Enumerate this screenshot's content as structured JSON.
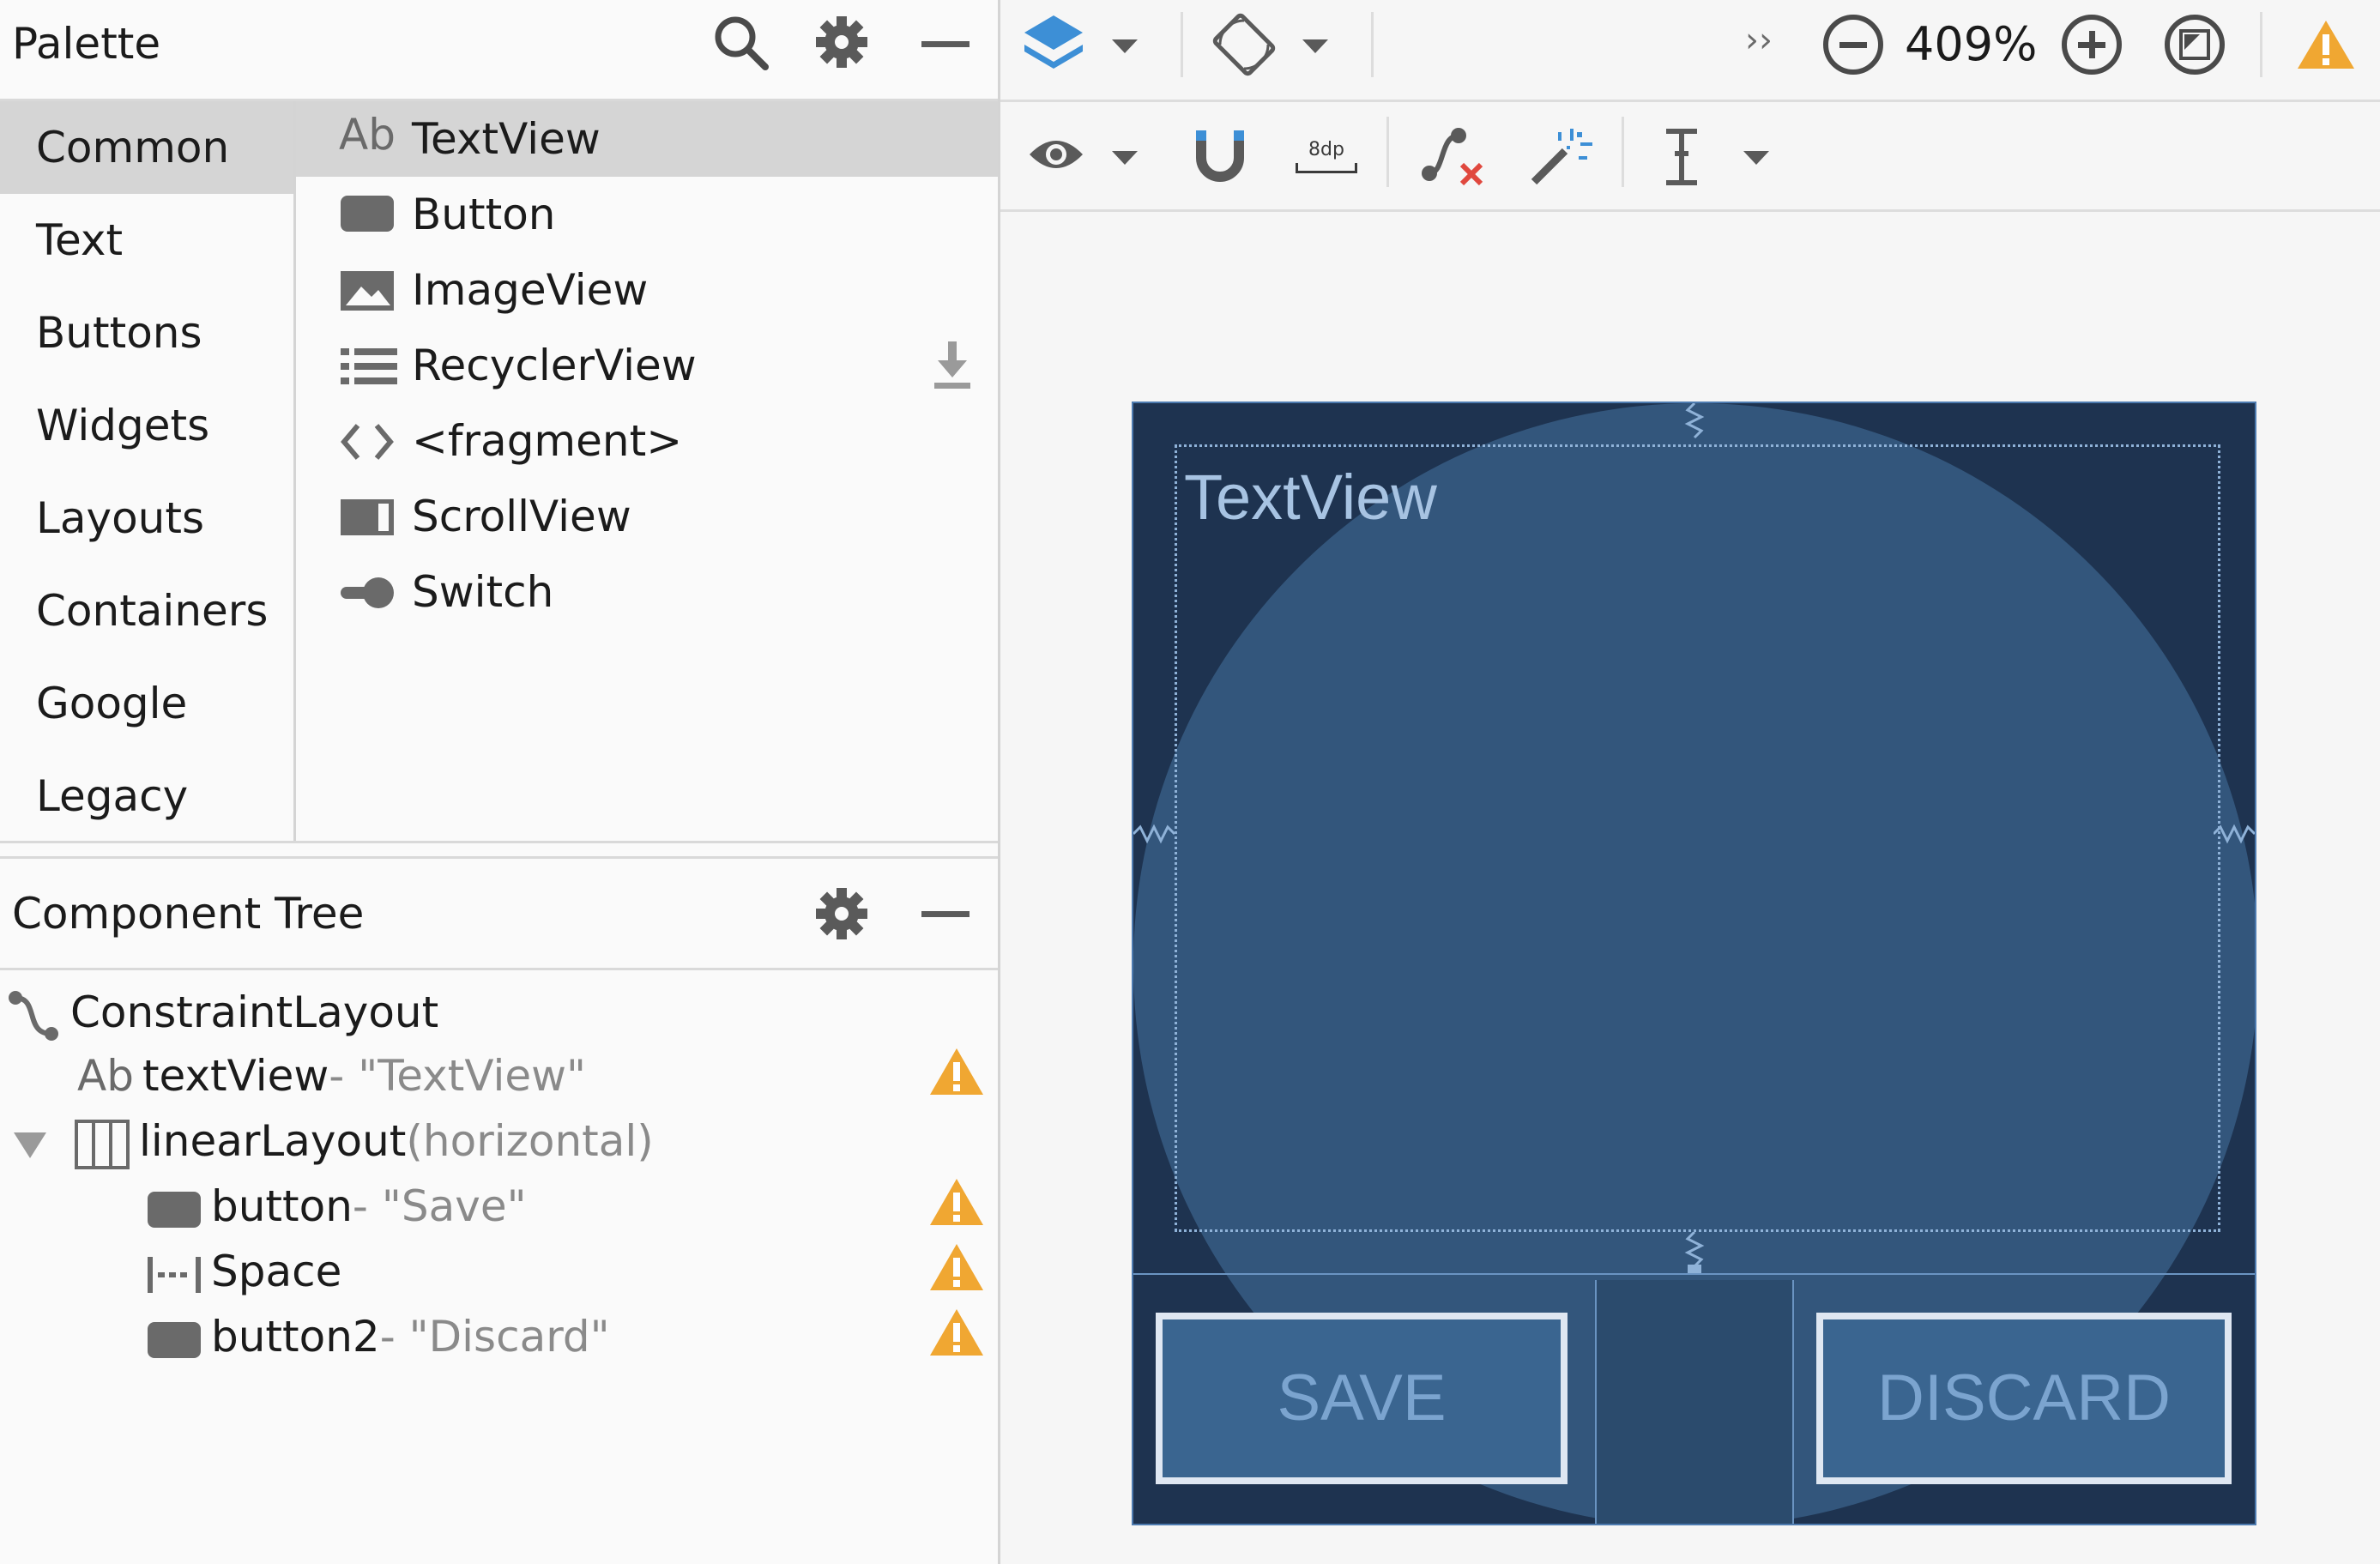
{
  "palette": {
    "title": "Palette",
    "categories": [
      "Common",
      "Text",
      "Buttons",
      "Widgets",
      "Layouts",
      "Containers",
      "Google",
      "Legacy"
    ],
    "selected_category": "Common",
    "items": [
      {
        "label": "TextView",
        "icon": "ab-text-icon"
      },
      {
        "label": "Button",
        "icon": "button-icon"
      },
      {
        "label": "ImageView",
        "icon": "image-icon"
      },
      {
        "label": "RecyclerView",
        "icon": "list-icon"
      },
      {
        "label": "<fragment>",
        "icon": "code-brackets-icon"
      },
      {
        "label": "ScrollView",
        "icon": "scrollview-icon"
      },
      {
        "label": "Switch",
        "icon": "switch-icon"
      }
    ]
  },
  "component_tree": {
    "title": "Component Tree",
    "nodes": [
      {
        "icon_text": "",
        "name": "ConstraintLayout",
        "suffix": ""
      },
      {
        "icon_text": "Ab",
        "name": "textView",
        "suffix": "- \"TextView\""
      },
      {
        "icon_text": "",
        "name": "linearLayout",
        "suffix": "(horizontal)"
      },
      {
        "icon_text": "",
        "name": "button",
        "suffix": "- \"Save\""
      },
      {
        "icon_text": "",
        "name": "Space",
        "suffix": ""
      },
      {
        "icon_text": "",
        "name": "button2",
        "suffix": "- \"Discard\""
      }
    ]
  },
  "toolbar": {
    "zoom_level": "409%",
    "margin_label": "8dp",
    "overflow_label": "››"
  },
  "canvas": {
    "textview_text": "TextView",
    "save_button_text": "SAVE",
    "discard_button_text": "DISCARD"
  },
  "colors": {
    "warning": "#f0a732",
    "blueprint_bg": "#1e3350",
    "accent_blue": "#3d8fd6"
  }
}
